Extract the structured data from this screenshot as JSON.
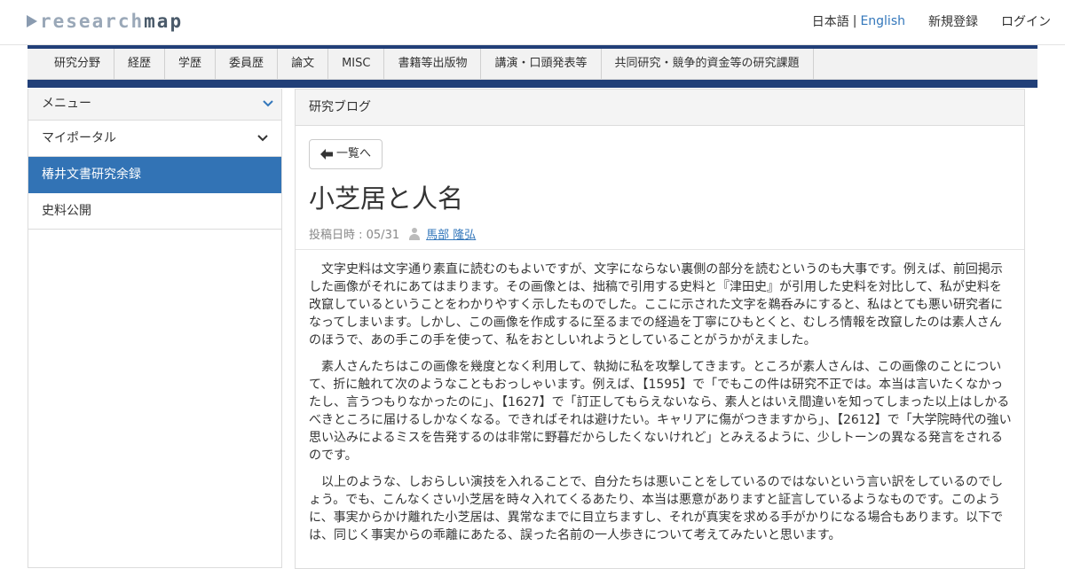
{
  "header": {
    "logo_part1": "research",
    "logo_part2": "map",
    "lang_ja": "日本語",
    "lang_sep": "|",
    "lang_en": "English",
    "register": "新規登録",
    "login": "ログイン"
  },
  "tabs": [
    "研究分野",
    "経歴",
    "学歴",
    "委員歴",
    "論文",
    "MISC",
    "書籍等出版物",
    "講演・口頭発表等",
    "共同研究・競争的資金等の研究課題"
  ],
  "sidebar": {
    "menu_label": "メニュー",
    "items": [
      {
        "label": "マイポータル"
      },
      {
        "label": "椿井文書研究余録"
      },
      {
        "label": "史料公開"
      }
    ]
  },
  "main": {
    "panel_title": "研究ブログ",
    "back_label": "一覧へ",
    "post_title": "小芝居と人名",
    "posted_label": "投稿日時 : 05/31",
    "author": "馬部 隆弘",
    "paragraphs": [
      "文字史料は文字通り素直に読むのもよいですが、文字にならない裏側の部分を読むというのも大事です。例えば、前回掲示した画像がそれにあてはまります。その画像とは、拙稿で引用する史料と『津田史』が引用した史料を対比して、私が史料を改竄しているということをわかりやすく示したものでした。ここに示された文字を鵜呑みにすると、私はとても悪い研究者になってしまいます。しかし、この画像を作成するに至るまでの経過を丁寧にひもとくと、むしろ情報を改竄したのは素人さんのほうで、あの手この手を使って、私をおとしいれようとしていることがうかがえました。",
      "素人さんたちはこの画像を幾度となく利用して、執拗に私を攻撃してきます。ところが素人さんは、この画像のことについて、折に触れて次のようなこともおっしゃいます。例えば、【1595】で「でもこの件は研究不正では。本当は言いたくなかったし、言うつもりなかったのに」、【1627】で「訂正してもらえないなら、素人とはいえ間違いを知ってしまった以上はしかるべきところに届けるしかなくなる。できればそれは避けたい。キャリアに傷がつきますから」、【2612】で「大学院時代の強い思い込みによるミスを告発するのは非常に野暮だからしたくないけれど」とみえるように、少しトーンの異なる発言をされるのです。",
      "以上のような、しおらしい演技を入れることで、自分たちは悪いことをしているのではないという言い訳をしているのでしょう。でも、こんなくさい小芝居を時々入れてくるあたり、本当は悪意がありますと証言しているようなものです。このように、事実からかけ離れた小芝居は、異常なまでに目立ちますし、それが真実を求める手がかりになる場合もあります。以下では、同じく事実からの乖離にあたる、誤った名前の一人歩きについて考えてみたいと思います。"
    ]
  }
}
